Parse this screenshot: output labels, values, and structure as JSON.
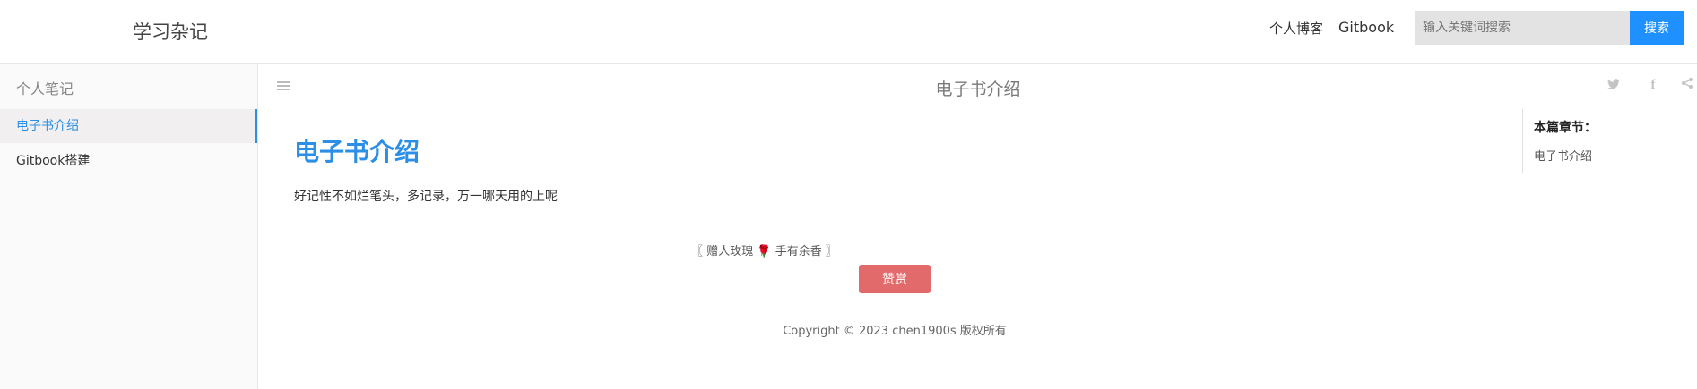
{
  "header": {
    "brand": "学习杂记",
    "nav": [
      {
        "label": "个人博客"
      },
      {
        "label": "Gitbook"
      }
    ],
    "search": {
      "placeholder": "输入关键词搜索",
      "value": "",
      "button_label": "搜索"
    }
  },
  "sidebar": {
    "header": "个人笔记",
    "items": [
      {
        "label": "电子书介绍",
        "active": true
      },
      {
        "label": "Gitbook搭建",
        "active": false
      }
    ]
  },
  "book_header": {
    "title": "电子书介绍",
    "icons": [
      "menu-icon",
      "twitter-icon",
      "facebook-icon",
      "share-icon"
    ]
  },
  "content": {
    "title": "电子书介绍",
    "paragraph": "好记性不如烂笔头，多记录，万一哪天用的上呢",
    "reward_text": "〖 赠人玫瑰 🌹 手有余香 〗",
    "reward_button": "赞赏",
    "copyright": "Copyright © 2023 chen1900s 版权所有"
  },
  "toc": {
    "title": "本篇章节：",
    "items": [
      "电子书介绍"
    ]
  },
  "colors": {
    "accent": "#2b8fe6",
    "search_button": "#1e90ff",
    "reward_button": "#e36a6a"
  }
}
